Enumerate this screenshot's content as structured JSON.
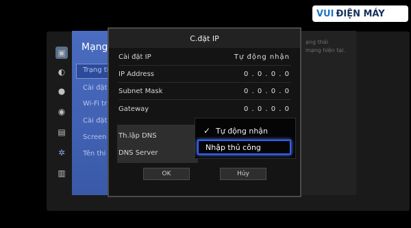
{
  "logo": {
    "brand_part1": "VUI",
    "brand_part2": "ĐIỆN MÁY"
  },
  "settings_menu": {
    "title": "Mạng",
    "items": [
      "Trạng th",
      "Cài đặt",
      "Wi-Fi tr",
      "Cài đặt",
      "Screen",
      "Tên thi"
    ]
  },
  "help_panel": {
    "lines": [
      "ạng thái",
      "mạng hiện tại."
    ]
  },
  "dialog": {
    "title": "C.đặt IP",
    "rows": [
      {
        "label": "Cài đặt IP",
        "value": "Tự động nhận"
      },
      {
        "label": "IP Address",
        "value": "0 . 0 . 0 . 0"
      },
      {
        "label": "Subnet Mask",
        "value": "0 . 0 . 0 . 0"
      },
      {
        "label": "Gateway",
        "value": "0 . 0 . 0 . 0"
      },
      {
        "label": "Th.lập DNS",
        "value": ""
      },
      {
        "label": "DNS Server",
        "value": ""
      }
    ],
    "ok_label": "OK",
    "cancel_label": "Hủy"
  },
  "dns_dropdown": {
    "options": [
      "Tự động nhận",
      "Nhập thủ công"
    ],
    "checked_option": "Tự động nhận",
    "focused_option": "Nhập thủ công",
    "check_icon": "checkmark-icon"
  },
  "colors": {
    "menu_panel": "#3f63b5",
    "focus_ring": "#2b62ff",
    "logo_text": "#1c75c9"
  }
}
